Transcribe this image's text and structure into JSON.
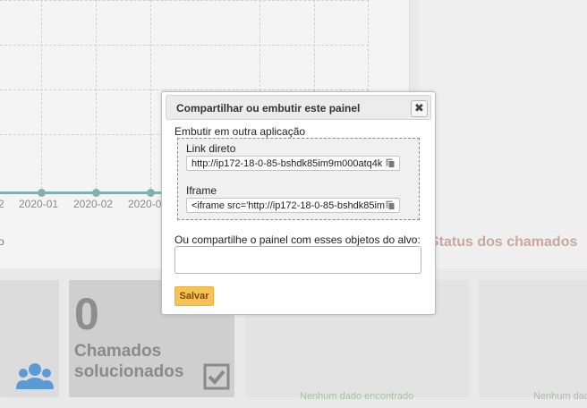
{
  "background": {
    "chart": {
      "x_ticks": [
        "2",
        "2020-01",
        "2020-02",
        "2020-0"
      ],
      "corner_label": "o"
    },
    "status_title": "Status dos chamados",
    "card_solved": {
      "value": "0",
      "label_line1": "Chamados",
      "label_line2": "solucionados"
    },
    "no_data_text": "Nenhum dado encontrado",
    "no_data_text_cut": "Nenhum dad"
  },
  "modal": {
    "title": "Compartilhar ou embutir este painel",
    "close_symbol": "✖",
    "embed_heading": "Embutir em outra aplicação",
    "direct_link_label": "Link direto",
    "direct_link_value": "http://ip172-18-0-85-bshdk85im9m000atq4k",
    "iframe_label": "Iframe",
    "iframe_value": "<iframe src='http://ip172-18-0-85-bshdk85im",
    "share_label": "Ou compartilhe o painel com esses objetos do alvo:",
    "share_value": "",
    "save_label": "Salvar"
  },
  "colors": {
    "accent_save": "#f6c255",
    "series": "#7fb3a8",
    "status_title": "#c9a89a"
  }
}
